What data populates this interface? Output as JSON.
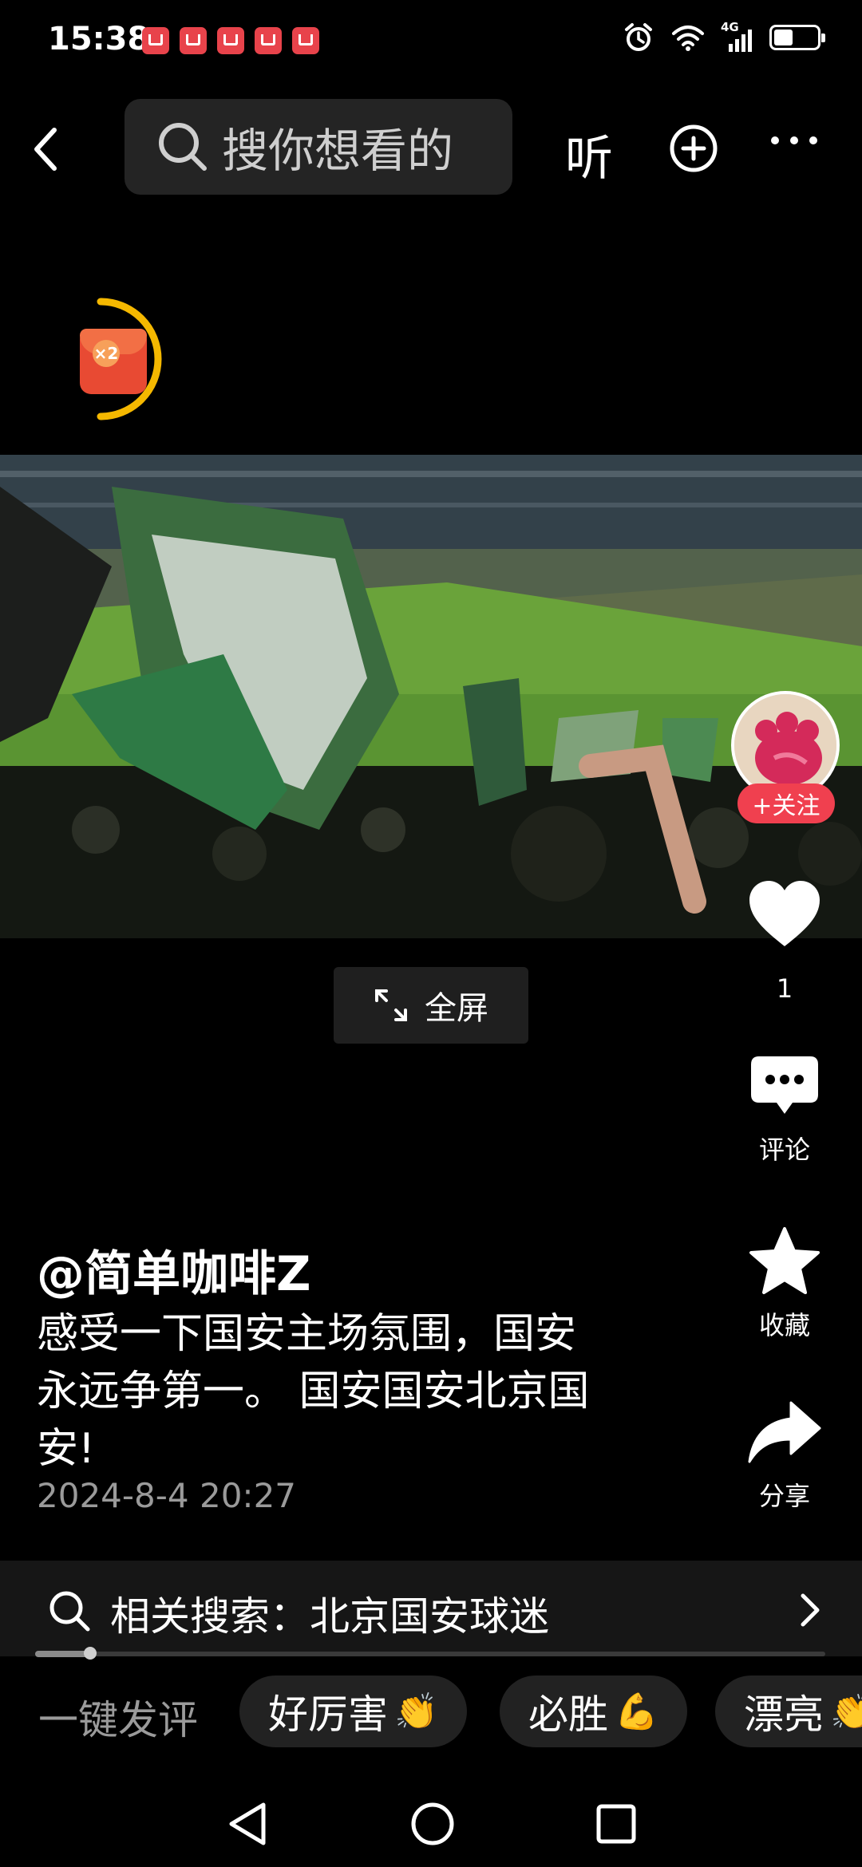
{
  "status_bar": {
    "time": "15:38",
    "network": "4G",
    "battery_level": 0.45,
    "notification_icons": [
      "app-notification-icon",
      "app-notification-icon",
      "huawei-app-icon",
      "app-notification-icon",
      "app-notification-icon"
    ]
  },
  "top_bar": {
    "search_placeholder": "搜你想看的",
    "listen_label": "听"
  },
  "video": {
    "fullscreen_label": "全屏"
  },
  "actions": {
    "follow_label": "+关注",
    "like_count": "1",
    "comment_label": "评论",
    "favorite_label": "收藏",
    "share_label": "分享"
  },
  "post": {
    "author": "@简单咖啡Z",
    "caption_line1": "感受一下国安主场氛围，国安",
    "caption_line2": "永远争第一。 国安国安北京国",
    "caption_line3": "安!",
    "date": "2024-8-4 20:27"
  },
  "related_search": {
    "text": "相关搜索：北京国安球迷",
    "progress": 0.07
  },
  "quick_comments": {
    "label": "一键发评",
    "chips": [
      {
        "text": "好厉害",
        "emoji": "👏"
      },
      {
        "text": "必胜",
        "emoji": "💪"
      },
      {
        "text": "漂亮",
        "emoji": "👏"
      }
    ]
  },
  "colors": {
    "background": "#000000",
    "follow_red": "#f0404f",
    "red_packet": "#e84a33",
    "ring_yellow": "#f5b800",
    "field_green": "#6da23c"
  }
}
